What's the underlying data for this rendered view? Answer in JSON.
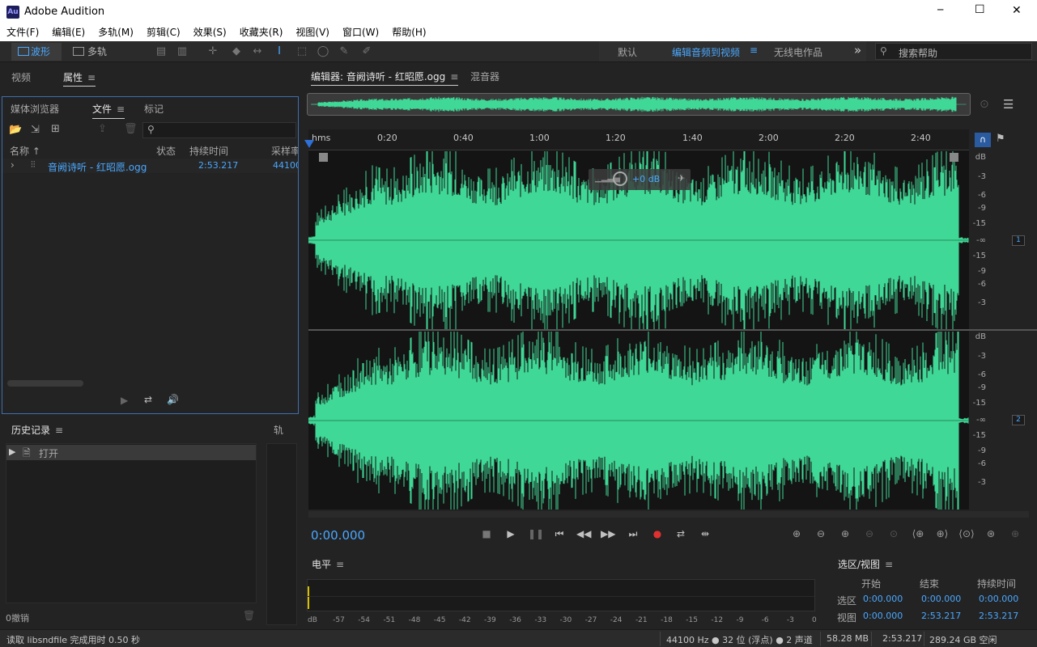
{
  "window": {
    "app_icon": "Au",
    "title": "Adobe Audition",
    "minimize": "─",
    "maximize": "☐",
    "close": "✕"
  },
  "menu": [
    "文件(F)",
    "编辑(E)",
    "多轨(M)",
    "剪辑(C)",
    "效果(S)",
    "收藏夹(R)",
    "视图(V)",
    "窗口(W)",
    "帮助(H)"
  ],
  "toolbar": {
    "waveform_label": "波形",
    "multitrack_label": "多轨",
    "workspaces": [
      "默认",
      "编辑音频到视频",
      "无线电作品"
    ],
    "overflow": "»",
    "search_placeholder": "搜索帮助"
  },
  "left_top_tabs": {
    "video": "视频",
    "properties": "属性"
  },
  "files_panel": {
    "tabs": {
      "media": "媒体浏览器",
      "files": "文件",
      "markers": "标记"
    },
    "columns": {
      "name": "名称",
      "status": "状态",
      "duration": "持续时间",
      "sample_rate": "采样率"
    },
    "rows": [
      {
        "name": "音阙诗听 - 红昭愿.ogg",
        "duration": "2:53.217",
        "sample_rate": "44100"
      }
    ]
  },
  "history_panel": {
    "title": "历史记录",
    "items": [
      "打开"
    ],
    "undo_count": "0撤销",
    "side_tab": "轨"
  },
  "editor": {
    "tab_label": "编辑器: 音阙诗听 - 红昭愿.ogg",
    "mixer_tab": "混音器",
    "ruler": [
      "hms",
      "0:20",
      "0:40",
      "1:00",
      "1:20",
      "1:40",
      "2:00",
      "2:20",
      "2:40"
    ],
    "hud_gain": "+0 dB",
    "db_scale": [
      "dB",
      "-3",
      "-6",
      "-9",
      "-15",
      "-∞",
      "-15",
      "-9",
      "-6",
      "-3"
    ],
    "channels": [
      "1",
      "2"
    ],
    "waveform_color": "#3fd896",
    "timecode": "0:00.000"
  },
  "levels_panel": {
    "title": "电平",
    "scale": [
      "dB",
      "-57",
      "-54",
      "-51",
      "-48",
      "-45",
      "-42",
      "-39",
      "-36",
      "-33",
      "-30",
      "-27",
      "-24",
      "-21",
      "-18",
      "-15",
      "-12",
      "-9",
      "-6",
      "-3",
      "0"
    ]
  },
  "selection_view": {
    "title": "选区/视图",
    "headers": {
      "start": "开始",
      "end": "结束",
      "duration": "持续时间"
    },
    "selection": {
      "label": "选区",
      "start": "0:00.000",
      "end": "0:00.000",
      "duration": "0:00.000"
    },
    "view": {
      "label": "视图",
      "start": "0:00.000",
      "end": "2:53.217",
      "duration": "2:53.217"
    }
  },
  "status_bar": {
    "message": "读取 libsndfile 完成用时 0.50 秒",
    "format": "44100 Hz ● 32 位 (浮点) ● 2 声道",
    "file_size": "58.28 MB",
    "duration": "2:53.217",
    "free_space": "289.24 GB 空闲"
  },
  "colors": {
    "accent": "#4aa8ff",
    "waveform": "#3fd896",
    "panel_focus": "#3c6fb0",
    "record": "#e03030"
  }
}
